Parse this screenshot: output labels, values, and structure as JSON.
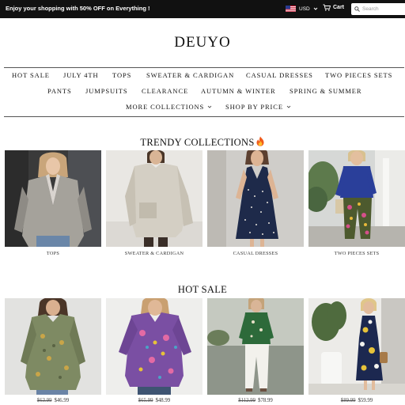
{
  "announcement": "Enjoy your shopping with 50% OFF on Everything !",
  "currency": {
    "code": "USD",
    "flag_icon": "us-flag-icon"
  },
  "cart_label": "Cart",
  "search": {
    "placeholder": "Search"
  },
  "logo": "DEUYO",
  "nav": {
    "row1": [
      "HOT SALE",
      "JULY 4TH",
      "TOPS",
      "SWEATER & CARDIGAN",
      "CASUAL DRESSES",
      "TWO PIECES SETS"
    ],
    "row2": [
      "PANTS",
      "JUMPSUITS",
      "CLEARANCE",
      "AUTUMN & WINTER",
      "SPRING & SUMMER"
    ],
    "row3": [
      "MORE COLLECTIONS",
      "SHOP BY PRICE"
    ]
  },
  "trendy": {
    "title": "TRENDY COLLECTIONS",
    "items": [
      {
        "caption": "TOPS",
        "image": "woman-grey-cardigan-photo"
      },
      {
        "caption": "SWEATER & CARDIGAN",
        "image": "woman-cream-sweater-photo"
      },
      {
        "caption": "CASUAL DRESSES",
        "image": "woman-navy-polka-dress-photo"
      },
      {
        "caption": "TWO PIECES SETS",
        "image": "woman-blue-top-floral-pants-photo"
      }
    ]
  },
  "hot_sale": {
    "title": "HOT SALE",
    "items": [
      {
        "old_price": "$63.99",
        "price": "$46.99",
        "image": "woman-olive-floral-tunic-photo"
      },
      {
        "old_price": "$65.99",
        "price": "$48.99",
        "image": "woman-purple-paisley-blouse-photo"
      },
      {
        "old_price": "$112.99",
        "price": "$78.99",
        "image": "woman-green-top-white-pants-photo"
      },
      {
        "old_price": "$89.99",
        "price": "$59.99",
        "image": "woman-navy-floral-dress-photo"
      }
    ]
  },
  "colors": {
    "announce_bg": "#111111",
    "text": "#222222"
  }
}
